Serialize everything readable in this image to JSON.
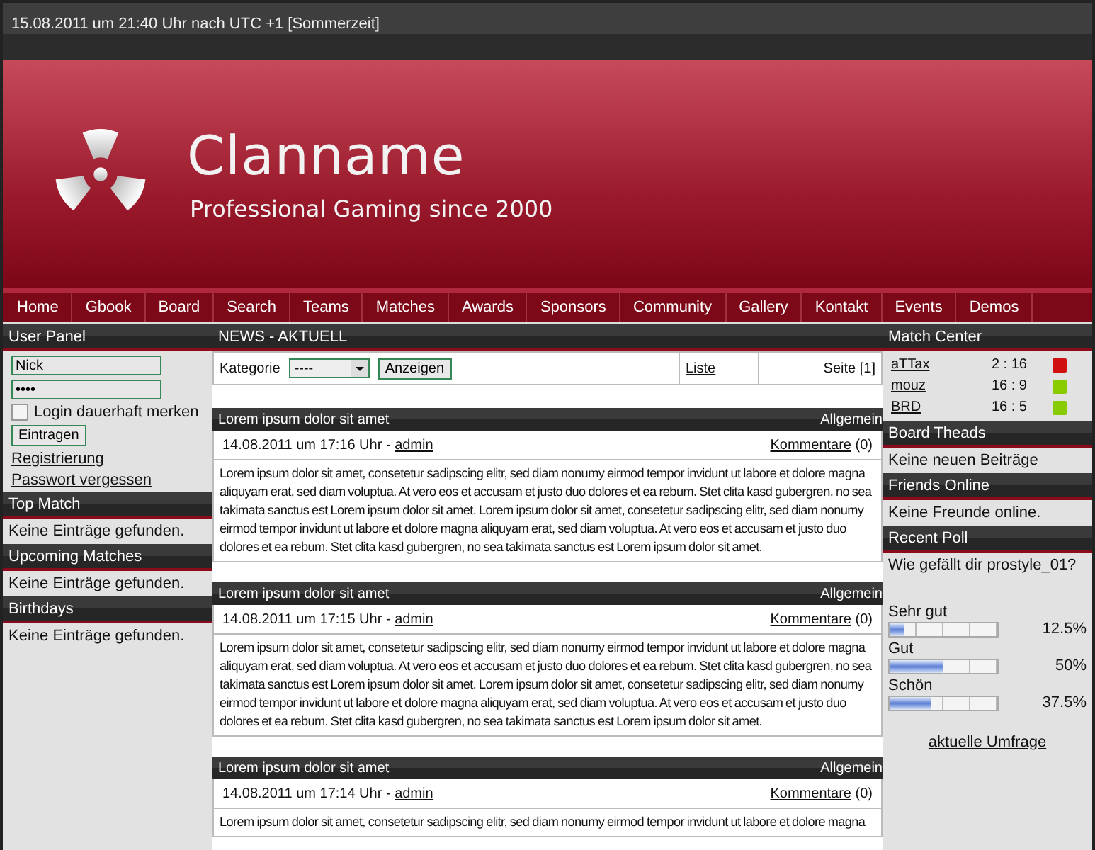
{
  "top_bar": {
    "datetime": "15.08.2011 um 21:40 Uhr nach UTC +1 [Sommerzeit]"
  },
  "header": {
    "title": "Clanname",
    "subtitle": "Professional Gaming since 2000"
  },
  "nav": [
    "Home",
    "Gbook",
    "Board",
    "Search",
    "Teams",
    "Matches",
    "Awards",
    "Sponsors",
    "Community",
    "Gallery",
    "Kontakt",
    "Events",
    "Demos"
  ],
  "left": {
    "user_panel": {
      "title": "User Panel",
      "username": "Nick",
      "password": "••••",
      "remember": {
        "label": "Login dauerhaft merken",
        "checked": false
      },
      "submit": "Eintragen",
      "links": [
        "Registrierung",
        "Passwort vergessen"
      ]
    },
    "boxes": [
      {
        "title": "Top Match",
        "text": "Keine Einträge gefunden."
      },
      {
        "title": "Upcoming Matches",
        "text": "Keine Einträge gefunden."
      },
      {
        "title": "Birthdays",
        "text": "Keine Einträge gefunden."
      }
    ]
  },
  "news": {
    "title": "NEWS - AKTUELL",
    "filter": {
      "label": "Kategorie",
      "value": "----",
      "button": "Anzeigen",
      "list_link": "Liste",
      "page": "Seite [1]"
    },
    "posts": [
      {
        "title": "Lorem ipsum dolor sit amet",
        "category": "Allgemein",
        "date": "14.08.2011 um 17:16 Uhr - ",
        "author": "admin",
        "comments_link": "Kommentare",
        "comments_count": " (0)",
        "body": "Lorem ipsum dolor sit amet, consetetur sadipscing elitr, sed diam nonumy eirmod tempor invidunt ut labore et dolore magna aliquyam erat, sed diam voluptua. At vero eos et accusam et justo duo dolores et ea rebum. Stet clita kasd gubergren, no sea takimata sanctus est Lorem ipsum dolor sit amet. Lorem ipsum dolor sit amet, consetetur sadipscing elitr, sed diam nonumy eirmod tempor invidunt ut labore et dolore magna aliquyam erat, sed diam voluptua. At vero eos et accusam et justo duo dolores et ea rebum. Stet clita kasd gubergren, no sea takimata sanctus est Lorem ipsum dolor sit amet."
      },
      {
        "title": "Lorem ipsum dolor sit amet",
        "category": "Allgemein",
        "date": "14.08.2011 um 17:15 Uhr - ",
        "author": "admin",
        "comments_link": "Kommentare",
        "comments_count": " (0)",
        "body": "Lorem ipsum dolor sit amet, consetetur sadipscing elitr, sed diam nonumy eirmod tempor invidunt ut labore et dolore magna aliquyam erat, sed diam voluptua. At vero eos et accusam et justo duo dolores et ea rebum. Stet clita kasd gubergren, no sea takimata sanctus est Lorem ipsum dolor sit amet. Lorem ipsum dolor sit amet, consetetur sadipscing elitr, sed diam nonumy eirmod tempor invidunt ut labore et dolore magna aliquyam erat, sed diam voluptua. At vero eos et accusam et justo duo dolores et ea rebum. Stet clita kasd gubergren, no sea takimata sanctus est Lorem ipsum dolor sit amet."
      },
      {
        "title": "Lorem ipsum dolor sit amet",
        "category": "Allgemein",
        "date": "14.08.2011 um 17:14 Uhr - ",
        "author": "admin",
        "comments_link": "Kommentare",
        "comments_count": " (0)",
        "body": "Lorem ipsum dolor sit amet, consetetur sadipscing elitr, sed diam nonumy eirmod tempor invidunt ut labore et dolore magna"
      }
    ]
  },
  "right": {
    "match_center": {
      "title": "Match Center",
      "matches": [
        {
          "team": "aTTax",
          "score": "2 : 16",
          "color": "#d01010"
        },
        {
          "team": "mouz",
          "score": "16 : 9",
          "color": "#88cc00"
        },
        {
          "team": "BRD",
          "score": "16 : 5",
          "color": "#88cc00"
        }
      ]
    },
    "boxes": [
      {
        "title": "Board Theads",
        "text": "Keine neuen Beiträge"
      },
      {
        "title": "Friends Online",
        "text": "Keine Freunde online."
      }
    ],
    "poll": {
      "title": "Recent Poll",
      "question": "Wie gefällt dir prostyle_01?",
      "options": [
        {
          "label": "Sehr gut",
          "level": 0.125,
          "percent": "12.5%"
        },
        {
          "label": "Gut",
          "level": 0.5,
          "percent": "50%"
        },
        {
          "label": "Schön",
          "level": 0.375,
          "percent": "37.5%"
        }
      ],
      "link": "aktuelle Umfrage"
    }
  }
}
